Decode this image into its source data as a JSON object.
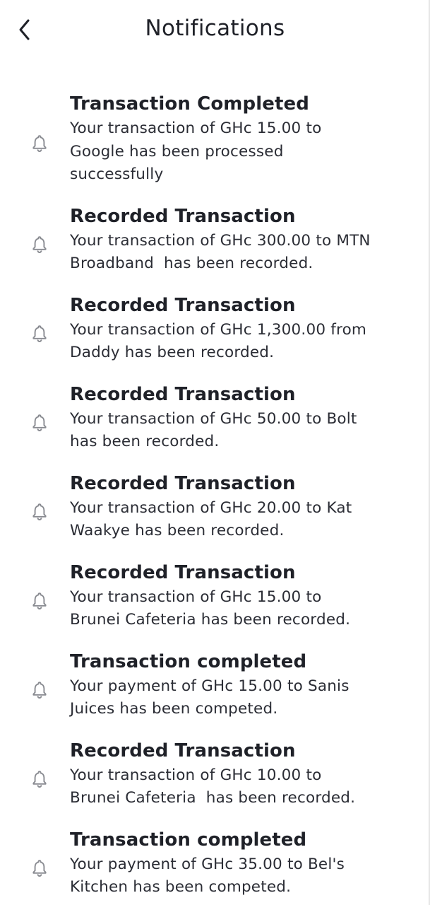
{
  "header": {
    "title": "Notifications",
    "back_icon": "chevron-left-icon"
  },
  "colors": {
    "text": "#1f2128",
    "icon": "#8a8c92",
    "background": "#ffffff"
  },
  "notifications": [
    {
      "title": "Transaction Completed",
      "lines": [
        "Your transaction of GHc 15.00 to",
        "Google has been processed",
        "successfully"
      ],
      "icon": "bell-icon"
    },
    {
      "title": "Recorded Transaction",
      "lines": [
        "Your transaction of GHc 300.00 to MTN",
        "Broadband  has been recorded."
      ],
      "icon": "bell-icon"
    },
    {
      "title": "Recorded Transaction",
      "lines": [
        "Your transaction of GHc 1,300.00 from",
        "Daddy has been recorded."
      ],
      "icon": "bell-icon"
    },
    {
      "title": "Recorded Transaction",
      "lines": [
        "Your transaction of GHc 50.00 to Bolt",
        "has been recorded."
      ],
      "icon": "bell-icon"
    },
    {
      "title": "Recorded Transaction",
      "lines": [
        "Your transaction of GHc 20.00 to Kat",
        "Waakye has been recorded."
      ],
      "icon": "bell-icon"
    },
    {
      "title": "Recorded Transaction",
      "lines": [
        "Your transaction of GHc 15.00 to",
        "Brunei Cafeteria has been recorded."
      ],
      "icon": "bell-icon"
    },
    {
      "title": "Transaction completed",
      "lines": [
        "Your payment of GHc 15.00 to Sanis",
        "Juices has been competed."
      ],
      "icon": "bell-icon"
    },
    {
      "title": "Recorded Transaction",
      "lines": [
        "Your transaction of GHc 10.00 to",
        "Brunei Cafeteria  has been recorded."
      ],
      "icon": "bell-icon"
    },
    {
      "title": "Transaction completed",
      "lines": [
        "Your payment of GHc 35.00 to Bel's",
        "Kitchen has been competed."
      ],
      "icon": "bell-icon"
    }
  ]
}
